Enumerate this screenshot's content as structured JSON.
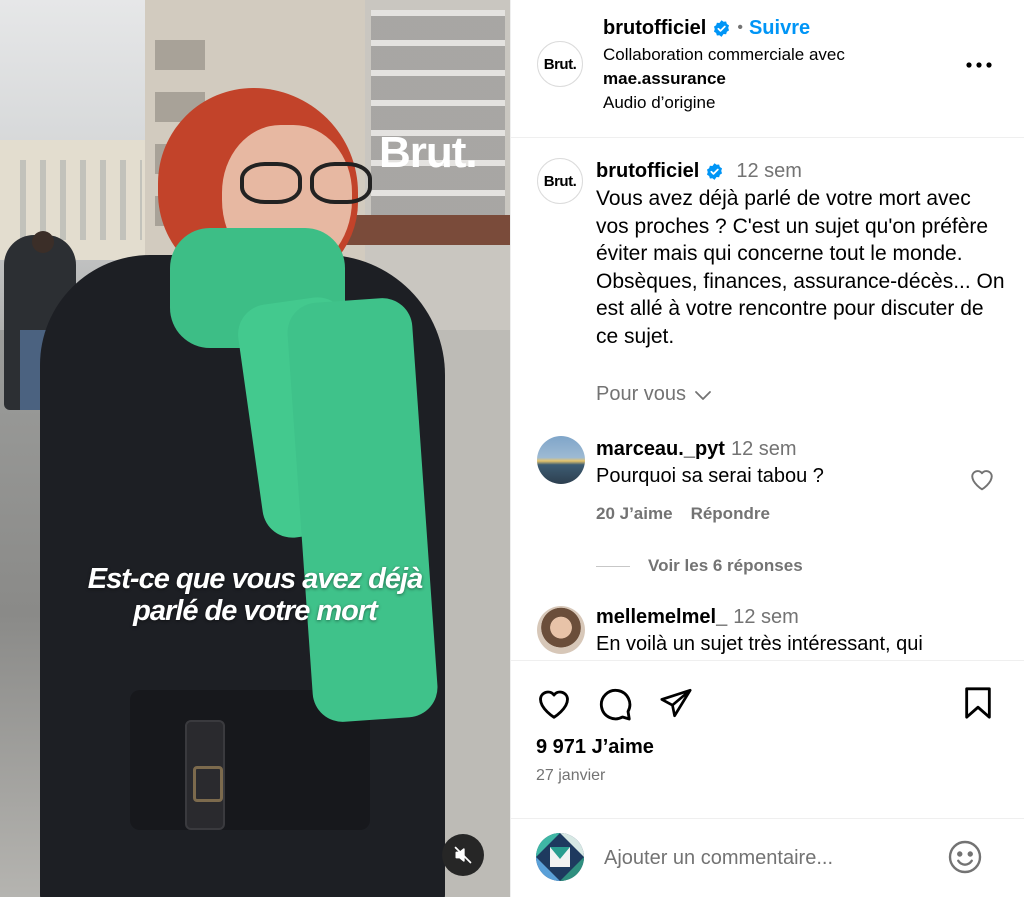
{
  "video": {
    "watermark": "Brut.",
    "subtitle_line1": "Est-ce que vous avez déjà",
    "subtitle_line2": "parlé de votre mort",
    "mute_icon": "speaker-muted-icon"
  },
  "post_header": {
    "avatar_text": "Brut.",
    "username": "brutofficiel",
    "separator": "•",
    "follow_label": "Suivre",
    "collab_label": "Collaboration commerciale avec",
    "partner": "mae.assurance",
    "audio": "Audio d’origine",
    "more_icon": "more-options-icon"
  },
  "caption": {
    "avatar_text": "Brut.",
    "username": "brutofficiel",
    "time": "12 sem",
    "text": "Vous avez déjà parlé de votre mort avec vos proches ? C'est un sujet qu'on préfère éviter mais qui concerne tout le monde. Obsèques, finances, assurance-décès... On est allé à votre rencontre pour discuter de ce sujet.",
    "for_you_label": "Pour vous"
  },
  "comments": [
    {
      "username": "marceau._pyt",
      "time": "12 sem",
      "text": "Pourquoi sa serai tabou ?",
      "likes_label": "20 J’aime",
      "reply_label": "Répondre",
      "view_replies_label": "Voir les 6 réponses"
    },
    {
      "username": "mellemelmel_",
      "time": "12 sem",
      "text": "En voilà un sujet très intéressant, qui"
    }
  ],
  "actions": {
    "likes": "9 971 J’aime",
    "date": "27 janvier"
  },
  "add_comment": {
    "placeholder": "Ajouter un commentaire..."
  },
  "colors": {
    "link_blue": "#0095f6",
    "secondary_text": "#737373",
    "verified_blue": "#0095f6",
    "scarf_green": "#3fc28a"
  }
}
